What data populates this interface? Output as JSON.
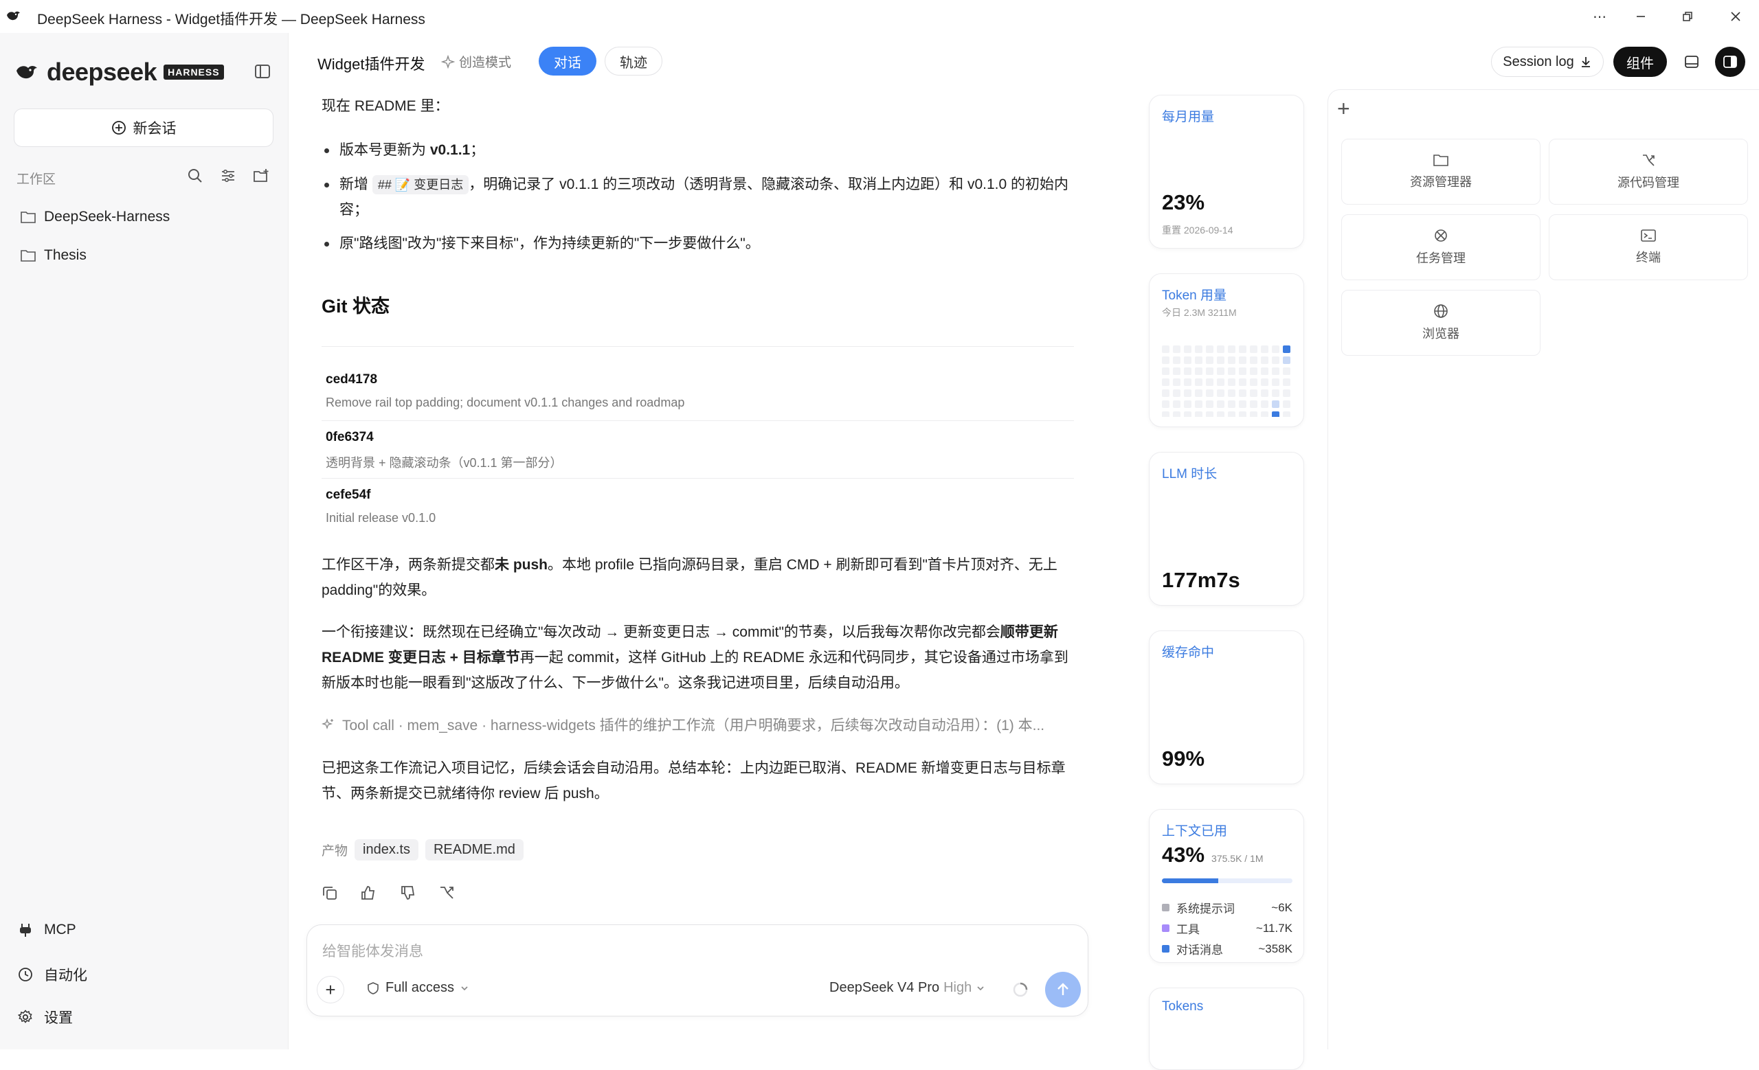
{
  "window": {
    "title": "DeepSeek Harness - Widget插件开发 — DeepSeek Harness",
    "controls": [
      "more-icon",
      "minimize-icon",
      "restore-icon",
      "close-icon"
    ]
  },
  "sidebar": {
    "brand": "deepseek",
    "brand_tag": "HARNESS",
    "new_chat": "新会话",
    "workspace_label": "工作区",
    "workspaces": [
      {
        "label": "DeepSeek-Harness",
        "icon": "folder-icon"
      },
      {
        "label": "Thesis",
        "icon": "folder-icon"
      }
    ],
    "bottom": [
      {
        "label": "MCP",
        "icon": "plug-icon"
      },
      {
        "label": "自动化",
        "icon": "clock-icon"
      },
      {
        "label": "设置",
        "icon": "gear-icon"
      }
    ]
  },
  "header": {
    "title": "Widget插件开发",
    "mode": "创造模式",
    "tabs": [
      {
        "label": "对话",
        "active": true
      },
      {
        "label": "轨迹",
        "active": false
      }
    ],
    "session_log": "Session log",
    "widgets": "组件"
  },
  "chat": {
    "intro": "现在 README 里：",
    "bullets": [
      {
        "pre": "版本号更新为 ",
        "bold": "v0.1.1",
        "post": "；"
      },
      {
        "pre": "新增 ",
        "code": "## 📝 变更日志",
        "post": "，明确记录了 v0.1.1 的三项改动（透明背景、隐藏滚动条、取消上内边距）和 v0.1.0 的初始内容；"
      },
      {
        "pre": "原\"路线图\"改为\"接下来目标\"，作为持续更新的\"下一步要做什么\"。"
      }
    ],
    "git_heading": "Git 状态",
    "commits": [
      {
        "hash": "ced4178",
        "msg": "Remove rail top padding; document v0.1.1 changes and roadmap"
      },
      {
        "hash": "0fe6374",
        "msg": "透明背景 + 隐藏滚动条（v0.1.1 第一部分）"
      },
      {
        "hash": "cefe54f",
        "msg": "Initial release v0.1.0"
      }
    ],
    "para1_a": "工作区干净，两条新提交都",
    "para1_bold": "未 push",
    "para1_b": "。本地 profile 已指向源码目录，重启 CMD + 刷新即可看到\"首卡片顶对齐、无上padding\"的效果。",
    "para2_a": "一个衔接建议：既然现在已经确立\"每次改动 → 更新变更日志 → commit\"的节奏，以后我每次帮你改完都会",
    "para2_bold": "顺带更新 README 变更日志 + 目标章节",
    "para2_b": "再一起 commit，这样 GitHub 上的 README 永远和代码同步，其它设备通过市场拿到新版本时也能一眼看到\"这版改了什么、下一步做什么\"。这条我记进项目里，后续自动沿用。",
    "toolcall": "Tool call · mem_save · harness-widgets 插件的维护工作流（用户明确要求，后续每次改动自动沿用）：(1) 本...",
    "para3": "已把这条工作流记入项目记忆，后续会话会自动沿用。总结本轮：上内边距已取消、README 新增变更日志与目标章节、两条新提交已就绪待你 review 后 push。",
    "products_label": "产物",
    "products": [
      "index.ts",
      "README.md"
    ],
    "actions": [
      "copy-icon",
      "thumbs-up-icon",
      "thumbs-down-icon",
      "branch-icon"
    ]
  },
  "composer": {
    "placeholder": "给智能体发消息",
    "access": "Full access",
    "model": "DeepSeek V4 Pro",
    "level": "High"
  },
  "stats": {
    "monthly": {
      "label": "每月用量",
      "value": "23%",
      "reset": "重置 2026-09-14"
    },
    "tokens_usage": {
      "label": "Token 用量",
      "today": "今日 2.3M 3211M"
    },
    "llm": {
      "label": "LLM 时长",
      "value": "177m7s"
    },
    "cache": {
      "label": "缓存命中",
      "value": "99%"
    },
    "context": {
      "label": "上下文已用",
      "value": "43%",
      "detail": "375.5K / 1M",
      "fill": 0.43,
      "rows": [
        {
          "label": "系统提示词",
          "value": "~6K",
          "color": "#b0b0b8"
        },
        {
          "label": "工具",
          "value": "~11.7K",
          "color": "#a78bfa"
        },
        {
          "label": "对话消息",
          "value": "~358K",
          "color": "#3b7be0"
        }
      ]
    },
    "tokens": {
      "label": "Tokens"
    }
  },
  "right_panel": {
    "tiles": [
      {
        "label": "资源管理器",
        "icon": "folder-icon"
      },
      {
        "label": "源代码管理",
        "icon": "git-branch-icon"
      },
      {
        "label": "任务管理",
        "icon": "task-icon"
      },
      {
        "label": "终端",
        "icon": "terminal-icon"
      },
      {
        "label": "浏览器",
        "icon": "globe-icon"
      }
    ]
  }
}
